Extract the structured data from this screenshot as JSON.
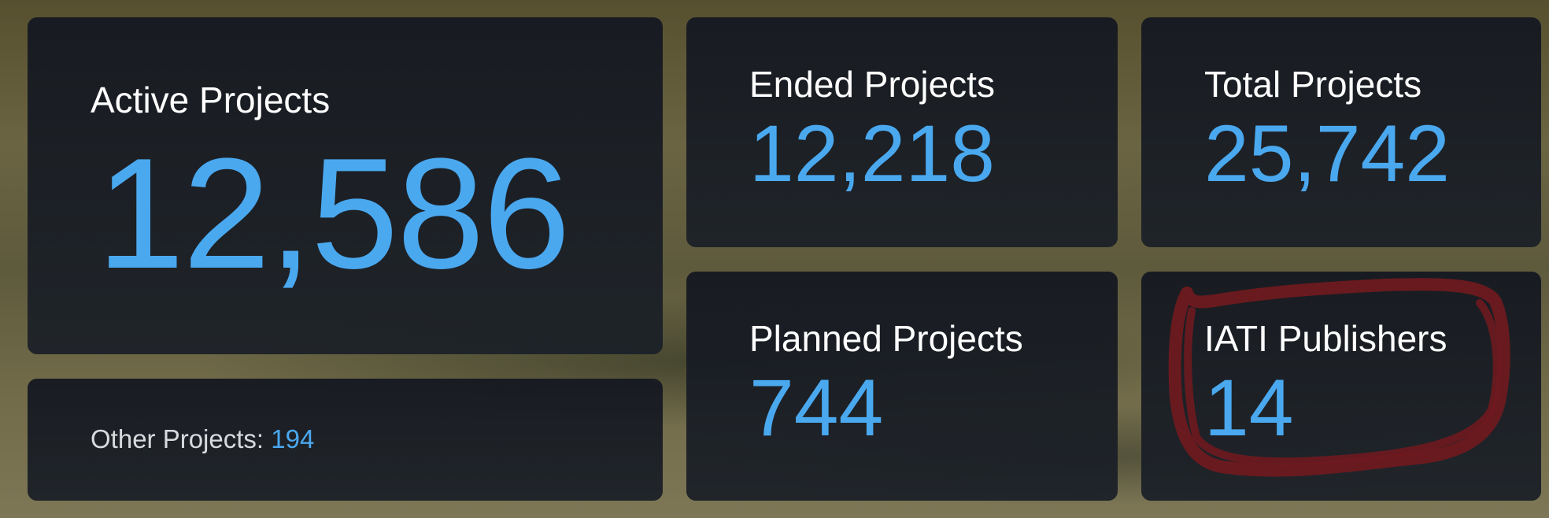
{
  "stats": {
    "active": {
      "label": "Active Projects",
      "value": "12,586"
    },
    "ended": {
      "label": "Ended Projects",
      "value": "12,218"
    },
    "total": {
      "label": "Total Projects",
      "value": "25,742"
    },
    "planned": {
      "label": "Planned Projects",
      "value": "744"
    },
    "iati": {
      "label": "IATI Publishers",
      "value": "14"
    },
    "other": {
      "label": "Other Projects:",
      "value": "194"
    }
  },
  "colors": {
    "card_bg": "#181d24",
    "value": "#4aa8ef",
    "label": "#ffffff",
    "annotation": "#6e1a1f"
  }
}
